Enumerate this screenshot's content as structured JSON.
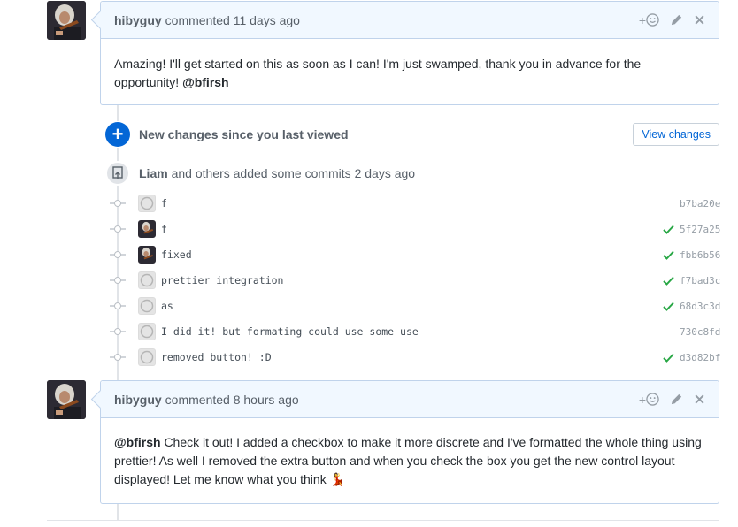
{
  "comments": [
    {
      "author": "hibyguy",
      "meta": "commented 11 days ago",
      "body_text": "Amazing! I'll get started on this as soon as I can! I'm just swamped, thank you in advance for the opportunity!",
      "mention": "@bfirsh"
    },
    {
      "author": "hibyguy",
      "meta": "commented 8 hours ago",
      "mention": "@bfirsh",
      "body_text": "Check it out! I added a checkbox to make it more discrete and I've formatted the whole thing using prettier! As well I removed the extra button and when you check the box you get the new control layout displayed! Let me know what you think",
      "emoji": "💃"
    }
  ],
  "comment_actions": {
    "reaction": "+",
    "edit_icon": "pencil-icon",
    "delete_icon": "close-icon"
  },
  "new_changes": {
    "label": "New changes since you last viewed",
    "button": "View changes"
  },
  "commits_header": {
    "author": "Liam",
    "text": "and others added some commits 2 days ago"
  },
  "commits": [
    {
      "message": "f",
      "sha": "b7ba20e",
      "status": "none",
      "avatar": "generic"
    },
    {
      "message": "f",
      "sha": "5f27a25",
      "status": "success",
      "avatar": "user"
    },
    {
      "message": "fixed",
      "sha": "fbb6b56",
      "status": "success",
      "avatar": "user"
    },
    {
      "message": "prettier integration",
      "sha": "f7bad3c",
      "status": "success",
      "avatar": "generic"
    },
    {
      "message": "as",
      "sha": "68d3c3d",
      "status": "success",
      "avatar": "generic"
    },
    {
      "message": "I did it! but formating could use some use",
      "sha": "730c8fd",
      "status": "none",
      "avatar": "generic"
    },
    {
      "message": "removed button! :D",
      "sha": "d3d82bf",
      "status": "success",
      "avatar": "generic"
    }
  ],
  "colors": {
    "accent": "#0366d6",
    "success": "#28a745",
    "header_bg": "#f1f8ff",
    "border": "#c0d3eb"
  }
}
